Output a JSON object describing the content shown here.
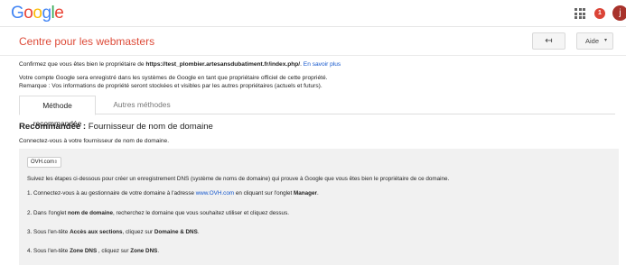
{
  "topbar": {
    "logo": "Google",
    "apps_icon": "apps-grid-icon",
    "notification_count": "1",
    "avatar_letter": "j"
  },
  "header": {
    "title": "Centre pour les webmasters",
    "back_icon": "↤",
    "help_label": "Aide",
    "help_caret": "▾"
  },
  "intro": {
    "confirm_prefix": "Confirmez que vous êtes bien le propriétaire de ",
    "site_url": "https://test_plombier.artesansdubatiment.fr/index.php/",
    "confirm_suffix": ". ",
    "learn_more": "En savoir plus",
    "owner_line1": "Votre compte Google sera enregistré dans les systèmes de Google en tant que propriétaire officiel de cette propriété.",
    "owner_line2": "Remarque : Vos informations de propriété seront stockées et visibles par les autres propriétaires (actuels et futurs)."
  },
  "tabs": [
    {
      "label": "Méthode recommandée",
      "active": true
    },
    {
      "label": "Autres méthodes",
      "active": false
    }
  ],
  "recommended": {
    "heading_bold": "Recommandée :",
    "heading_rest": " Fournisseur de nom de domaine",
    "connect_text": "Connectez-vous à votre fournisseur de nom de domaine."
  },
  "panel": {
    "provider_selected": "OVH.com",
    "intro_text": "Suivez les étapes ci-dessous pour créer un enregistrement DNS (système de noms de domaine) qui prouve à Google que vous êtes bien le propriétaire de ce domaine.",
    "step1_prefix": "1. Connectez-vous à au gestionnaire de votre domaine à l'adresse ",
    "step1_link": "www.OVH.com",
    "step1_mid": " en cliquant sur l'onglet ",
    "step1_bold": "Manager",
    "step1_suffix": ".",
    "step2_prefix": "2. Dans l'onglet ",
    "step2_bold": "nom de domaine",
    "step2_suffix": ", recherchez le domaine que vous souhaitez utiliser et cliquez dessus.",
    "step3_prefix": "3. Sous l'en-tête ",
    "step3_bold1": "Accès aux sections",
    "step3_mid": ", cliquez sur ",
    "step3_bold2": "Domaine & DNS",
    "step3_suffix": ".",
    "step4_prefix": "4. Sous l'en-tête ",
    "step4_bold1": "Zone DNS",
    "step4_mid": " , cliquez sur ",
    "step4_bold2": "Zone DNS",
    "step4_suffix": "."
  },
  "colors": {
    "title_red": "#dd4b39",
    "link_blue": "#1155cc",
    "panel_bg": "#f1f1f1"
  }
}
